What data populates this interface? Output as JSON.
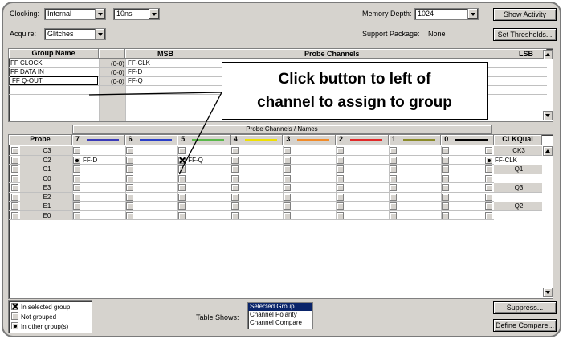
{
  "top": {
    "clocking_label": "Clocking:",
    "clocking_value": "Internal",
    "period_value": "10ns",
    "acquire_label": "Acquire:",
    "acquire_value": "Glitches",
    "memory_depth_label": "Memory Depth:",
    "memory_depth_value": "1024",
    "support_package_label": "Support Package:",
    "support_package_value": "None",
    "show_activity_label": "Show Activity",
    "set_thresholds_label": "Set Thresholds..."
  },
  "groups": {
    "headers": {
      "group_name": "Group Name",
      "msb": "MSB",
      "probe_channels": "Probe Channels",
      "lsb": "LSB"
    },
    "rows": [
      {
        "name": "FF CLOCK",
        "range": "(0-0)",
        "msb": "FF-CLK"
      },
      {
        "name": "FF DATA IN",
        "range": "(0-0)",
        "msb": "FF-D"
      },
      {
        "name": "FF Q-OUT",
        "range": "(0-0)",
        "msb": "FF-Q"
      }
    ]
  },
  "callout": {
    "line1": "Click button to left of",
    "line2": "channel to assign to group"
  },
  "probes": {
    "section_title": "Probe Channels / Names",
    "probe_header": "Probe",
    "clkqual_header": "CLKQual",
    "columns": [
      {
        "label": "7",
        "color": "#3a3ab8"
      },
      {
        "label": "6",
        "color": "#2a3ec8"
      },
      {
        "label": "5",
        "color": "#5ab84a"
      },
      {
        "label": "4",
        "color": "#f0e000"
      },
      {
        "label": "3",
        "color": "#f08a28"
      },
      {
        "label": "2",
        "color": "#e02828"
      },
      {
        "label": "1",
        "color": "#8a8a28"
      },
      {
        "label": "0",
        "color": "#000000"
      }
    ],
    "rows": [
      "C3",
      "C2",
      "C1",
      "C0",
      "E3",
      "E2",
      "E1",
      "E0"
    ],
    "names": {
      "c2_col7": "FF-D",
      "c2_col5": "FF-Q",
      "c2_clk": "FF-CLK"
    },
    "clkqual": [
      "CK3",
      "",
      "Q1",
      "",
      "Q3",
      "",
      "Q2",
      ""
    ]
  },
  "legend": {
    "in_selected": "In selected group",
    "not_grouped": "Not grouped",
    "in_other": "In other group(s)"
  },
  "table_shows": {
    "label": "Table Shows:",
    "options": [
      "Selected Group",
      "Channel Polarity",
      "Channel Compare"
    ],
    "selected": "Selected Group"
  },
  "buttons": {
    "suppress": "Suppress...",
    "define_compare": "Define Compare..."
  },
  "colors": {
    "accent_selection": "#0a246a",
    "window_bg": "#d6d3ce"
  }
}
